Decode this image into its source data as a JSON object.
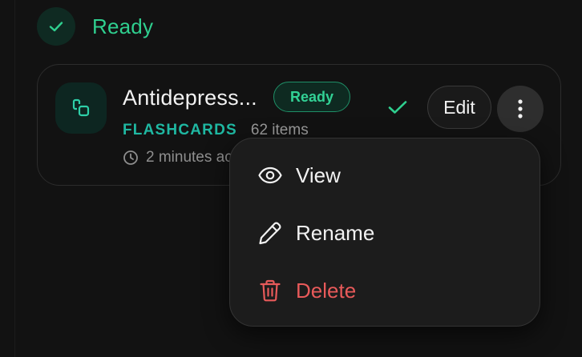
{
  "status": {
    "label": "Ready",
    "icon": "check-icon",
    "color": "#2fcf8f"
  },
  "card": {
    "title": "Antidepress...",
    "badge": "Ready",
    "type": "FLASHCARDS",
    "count": "62 items",
    "time": "2 minutes ac",
    "icon": "flashcards-icon",
    "edit_label": "Edit",
    "accent": "#1fb8a2"
  },
  "menu": {
    "items": [
      {
        "label": "View",
        "icon": "eye-icon"
      },
      {
        "label": "Rename",
        "icon": "pencil-icon"
      },
      {
        "label": "Delete",
        "icon": "trash-icon",
        "color": "#e85a5a"
      }
    ]
  }
}
